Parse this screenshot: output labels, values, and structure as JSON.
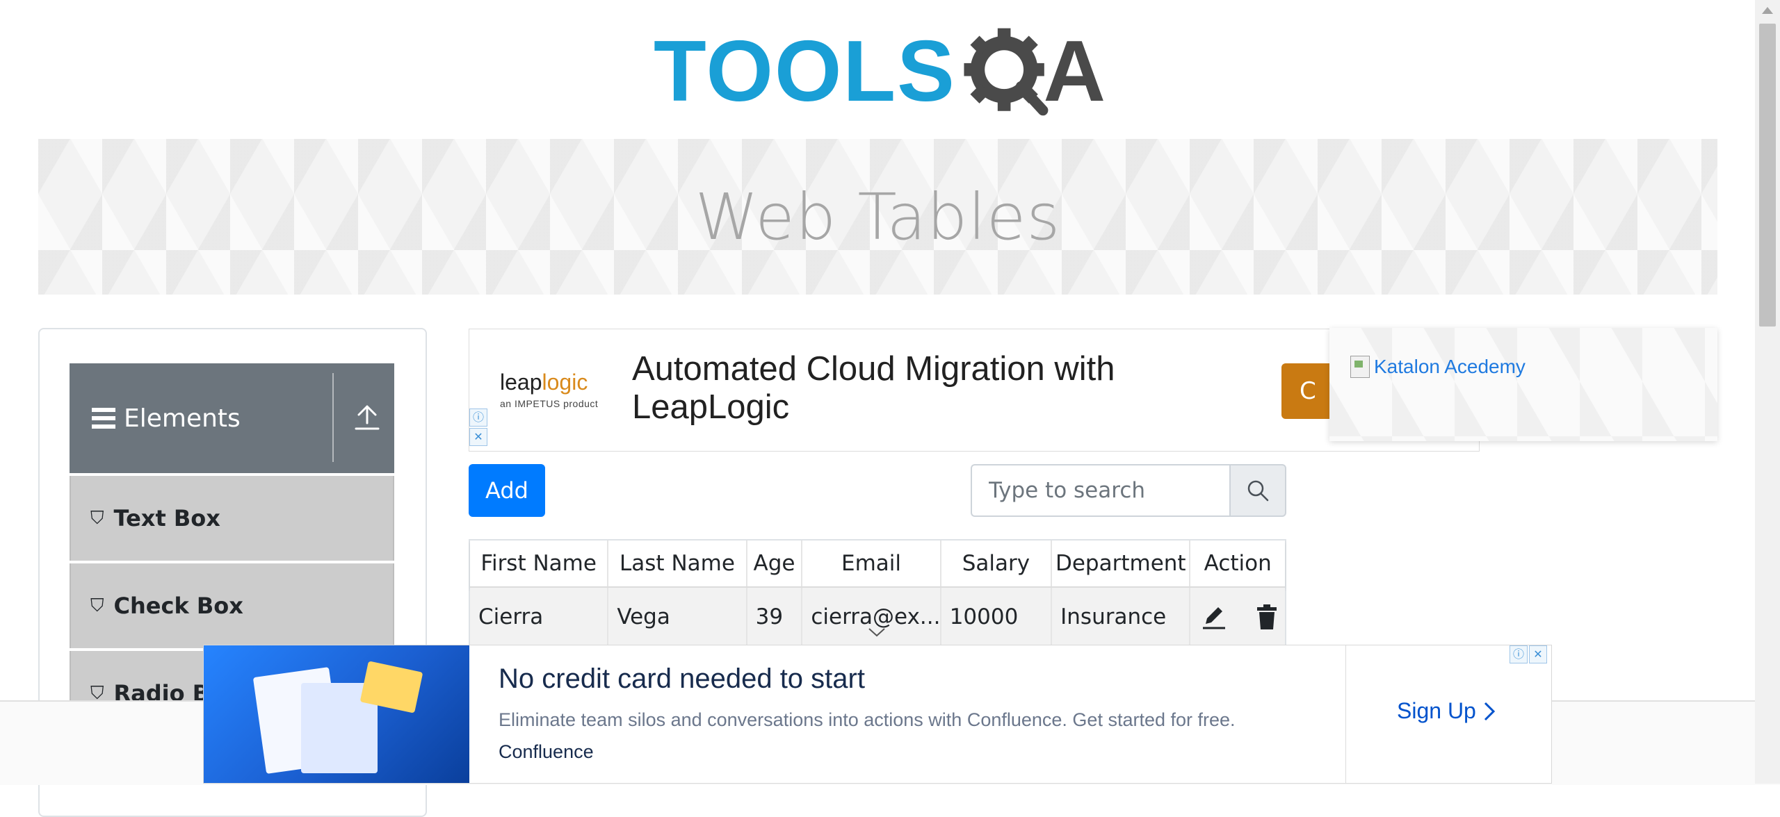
{
  "header": {
    "logo_text": "TOOLS",
    "logo_letter": "A",
    "logo_alt": "TOOLSQA"
  },
  "banner": {
    "title": "Web Tables"
  },
  "sidebar": {
    "group": {
      "label": "Elements"
    },
    "items": [
      {
        "label": "Text Box"
      },
      {
        "label": "Check Box"
      },
      {
        "label": "Radio Bu"
      }
    ]
  },
  "top_ad": {
    "brand": "leap",
    "brand_accent": "logic",
    "brand_sub": "an IMPETUS product",
    "headline": "Automated Cloud Migration with LeapLogic",
    "cta": "C",
    "info": "ⓘ",
    "close": "✕"
  },
  "overlay_ad": {
    "link_text": "Katalon Acedemy"
  },
  "toolbar": {
    "add_label": "Add",
    "search_placeholder": "Type to search"
  },
  "table": {
    "columns": [
      "First Name",
      "Last Name",
      "Age",
      "Email",
      "Salary",
      "Department",
      "Action"
    ],
    "rows": [
      {
        "first_name": "Cierra",
        "last_name": "Vega",
        "age": "39",
        "email": "cierra@ex...",
        "salary": "10000",
        "department": "Insurance"
      }
    ]
  },
  "bottom_ad": {
    "title": "No credit card needed to start",
    "description": "Eliminate team silos and conversations into actions with Confluence. Get started for free.",
    "advertiser": "Confluence",
    "cta": "Sign Up",
    "info": "ⓘ",
    "close": "✕"
  },
  "colors": {
    "primary": "#007bff",
    "logo_blue": "#1a9fd6",
    "logo_dark": "#4a4a4a",
    "sidebar_header": "#6c757d",
    "sidebar_item": "#cccccc"
  }
}
